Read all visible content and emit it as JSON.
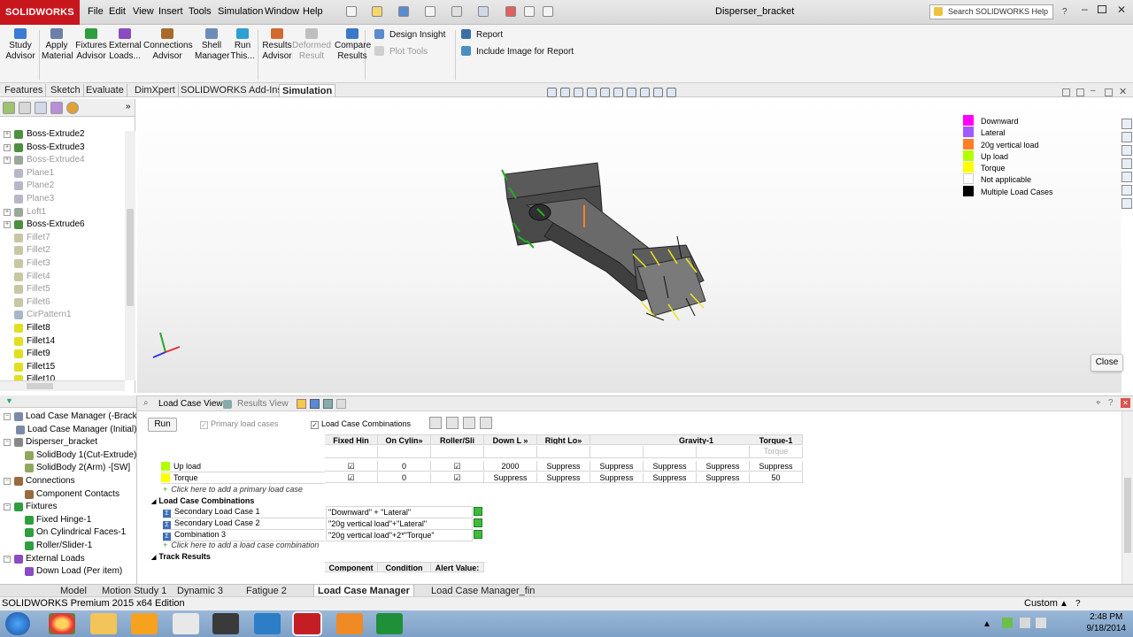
{
  "app": {
    "logo_text": "SOLIDWORKS",
    "doc_title": "Disperser_bracket",
    "search_placeholder": "Search SOLIDWORKS Help"
  },
  "menu": [
    "File",
    "Edit",
    "View",
    "Insert",
    "Tools",
    "Simulation",
    "Window",
    "Help"
  ],
  "commands": [
    {
      "label": "Study\nAdvisor",
      "color": "#3a7bd5",
      "disabled": false
    },
    {
      "label": "Apply\nMaterial",
      "color": "#6b7fa8",
      "disabled": false
    },
    {
      "label": "Fixtures\nAdvisor",
      "color": "#2e9e3f",
      "disabled": false
    },
    {
      "label": "External\nLoads...",
      "color": "#8a4cc2",
      "disabled": false
    },
    {
      "label": "Connections\nAdvisor",
      "color": "#a86a2b",
      "disabled": false
    },
    {
      "label": "Shell\nManager",
      "color": "#6c8dba",
      "disabled": false
    },
    {
      "label": "Run\nThis...",
      "color": "#2f9ed0",
      "disabled": false
    },
    {
      "label": "Results\nAdvisor",
      "color": "#d06a2f",
      "disabled": false
    },
    {
      "label": "Deformed\nResult",
      "color": "#bfbfbf",
      "disabled": true
    },
    {
      "label": "Compare\nResults",
      "color": "#3b78c9",
      "disabled": false
    }
  ],
  "cmd_rows": {
    "design_insight": "Design Insight",
    "plot_tools": "Plot Tools",
    "report": "Report",
    "include_image": "Include Image for Report"
  },
  "cmd_tabs": [
    "Features",
    "Sketch",
    "Evaluate",
    "DimXpert",
    "SOLIDWORKS Add-Ins",
    "Simulation"
  ],
  "active_cmd_tab": "Simulation",
  "feature_tree": [
    {
      "label": "Boss-Extrude2",
      "dim": false,
      "exp": true,
      "color": "#4d8f3f"
    },
    {
      "label": "Boss-Extrude3",
      "dim": false,
      "exp": true,
      "color": "#4d8f3f"
    },
    {
      "label": "Boss-Extrude4",
      "dim": true,
      "exp": true,
      "color": "#9aa89a"
    },
    {
      "label": "Plane1",
      "dim": true,
      "exp": false,
      "color": "#b7b7c9"
    },
    {
      "label": "Plane2",
      "dim": true,
      "exp": false,
      "color": "#b7b7c9"
    },
    {
      "label": "Plane3",
      "dim": true,
      "exp": false,
      "color": "#b7b7c9"
    },
    {
      "label": "Loft1",
      "dim": true,
      "exp": true,
      "color": "#9aa89a"
    },
    {
      "label": "Boss-Extrude6",
      "dim": false,
      "exp": true,
      "color": "#4d8f3f"
    },
    {
      "label": "Fillet7",
      "dim": true,
      "exp": false,
      "color": "#c7c7a5"
    },
    {
      "label": "Fillet2",
      "dim": true,
      "exp": false,
      "color": "#c7c7a5"
    },
    {
      "label": "Fillet3",
      "dim": true,
      "exp": false,
      "color": "#c7c7a5"
    },
    {
      "label": "Fillet4",
      "dim": true,
      "exp": false,
      "color": "#c7c7a5"
    },
    {
      "label": "Fillet5",
      "dim": true,
      "exp": false,
      "color": "#c7c7a5"
    },
    {
      "label": "Fillet6",
      "dim": true,
      "exp": false,
      "color": "#c7c7a5"
    },
    {
      "label": "CirPattern1",
      "dim": true,
      "exp": false,
      "color": "#a7b7c7"
    },
    {
      "label": "Fillet8",
      "dim": false,
      "exp": false,
      "color": "#e0e020"
    },
    {
      "label": "Fillet14",
      "dim": false,
      "exp": false,
      "color": "#e0e020"
    },
    {
      "label": "Fillet9",
      "dim": false,
      "exp": false,
      "color": "#e0e020"
    },
    {
      "label": "Fillet15",
      "dim": false,
      "exp": false,
      "color": "#e0e020"
    },
    {
      "label": "Fillet10",
      "dim": false,
      "exp": false,
      "color": "#e0e020"
    }
  ],
  "legend": [
    {
      "label": "Downward",
      "color": "#ff00ff"
    },
    {
      "label": "Lateral",
      "color": "#a259ff"
    },
    {
      "label": "20g vertical load",
      "color": "#ff7f27"
    },
    {
      "label": "Up load",
      "color": "#b3ff00"
    },
    {
      "label": "Torque",
      "color": "#ffff00"
    },
    {
      "label": "Not applicable",
      "color": "#ffffff"
    },
    {
      "label": "Multiple Load Cases",
      "color": "#000000"
    }
  ],
  "close_label": "Close",
  "views": {
    "load_case_view": "Load Case View",
    "results_view": "Results View"
  },
  "lc_tree": [
    {
      "label": "Load Case Manager (-Bracket-)",
      "indent": 0
    },
    {
      "label": "Load Case Manager (Initial)",
      "indent": 1
    },
    {
      "label": "Disperser_bracket",
      "indent": 0
    },
    {
      "label": "SolidBody 1(Cut-Extrude)",
      "indent": 2
    },
    {
      "label": "SolidBody 2(Arm) -[SW]",
      "indent": 2
    },
    {
      "label": "Connections",
      "indent": 0
    },
    {
      "label": "Component Contacts",
      "indent": 2
    },
    {
      "label": "Fixtures",
      "indent": 0
    },
    {
      "label": "Fixed Hinge-1",
      "indent": 2
    },
    {
      "label": "On Cylindrical Faces-1",
      "indent": 2
    },
    {
      "label": "Roller/Slider-1",
      "indent": 2
    },
    {
      "label": "External Loads",
      "indent": 0
    },
    {
      "label": "Down Load (Per item)",
      "indent": 2
    }
  ],
  "run_label": "Run",
  "primary_load_cases_label": "Primary load cases",
  "load_case_combinations_label": "Load Case Combinations",
  "grid": {
    "headers": [
      "Fixed Hin",
      "On Cylin»",
      "Roller/Sli",
      "Down L »",
      "Right Lo»",
      "Gravity-1",
      "Torque-1"
    ],
    "subheader_torque": "Torque",
    "primary_rows": [
      {
        "name": "Up load",
        "swatch": "#b3ff00",
        "cells": [
          "☑",
          "0",
          "☑",
          "2000",
          "Suppress",
          "Suppress",
          "Suppress",
          "Suppress",
          "Suppress"
        ]
      },
      {
        "name": "Torque",
        "swatch": "#ffff00",
        "cells": [
          "☑",
          "0",
          "☑",
          "Suppress",
          "Suppress",
          "Suppress",
          "Suppress",
          "Suppress",
          "50"
        ]
      }
    ],
    "add_primary": "Click here to add a primary load case",
    "combinations_title": "Load Case Combinations",
    "combinations": [
      {
        "name": "Secondary Load Case 1",
        "formula": "\"Downward\" + \"Lateral\""
      },
      {
        "name": "Secondary Load Case 2",
        "formula": "\"20g vertical load\"+\"Lateral\""
      },
      {
        "name": "Combination 3",
        "formula": "\"20g vertical load\"+2*\"Torque\""
      }
    ],
    "add_combination": "Click here to add a load case combination",
    "track_results": "Track Results",
    "track_headers": [
      "Component",
      "Condition",
      "Alert Value:"
    ]
  },
  "bottom_tabs": [
    "Model",
    "Motion Study 1",
    "Dynamic 3",
    "Fatigue 2",
    "Load Case Manager",
    "Load Case Manager_fin"
  ],
  "active_bottom_tab": "Load Case Manager",
  "status": {
    "edition": "SOLIDWORKS Premium 2015 x64 Edition",
    "custom": "Custom"
  },
  "clock": {
    "time": "2:48 PM",
    "date": "9/18/2014"
  }
}
